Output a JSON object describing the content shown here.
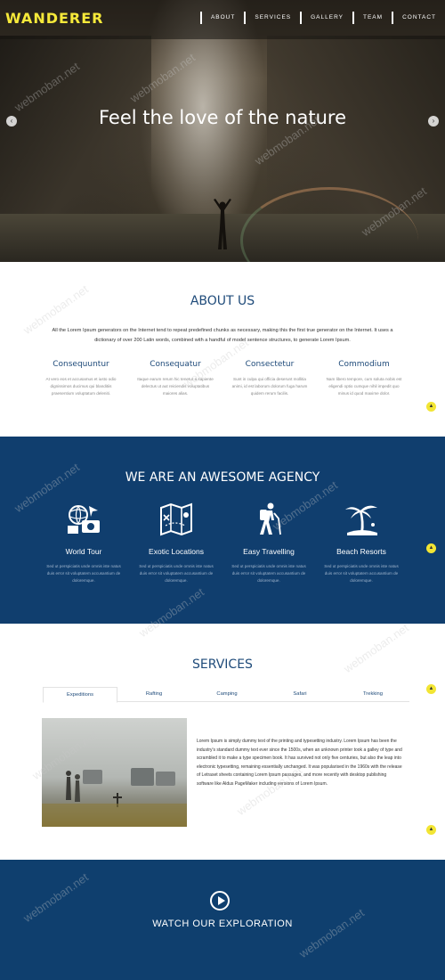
{
  "header": {
    "logo": "WANDERER",
    "nav": [
      "ABOUT",
      "SERVICES",
      "GALLERY",
      "TEAM",
      "CONTACT"
    ]
  },
  "hero": {
    "title": "Feel the love of the nature",
    "prev_icon": "chevron-left-icon",
    "next_icon": "chevron-right-icon"
  },
  "about": {
    "title": "ABOUT US",
    "text": "All the Lorem Ipsum generators on the Internet tend to repeat predefined chunks as necessary, making this the first true generator on the Internet. It uses a dictionary of over 200 Latin words, combined with a handful of model sentence structures, to generate Lorem Ipsum.",
    "features": [
      {
        "title": "Consequuntur",
        "text": "At vero eos et accusamus et iusto odio dignissimos ducimus qui blanditiis praesentium voluptatum deleniti."
      },
      {
        "title": "Consequatur",
        "text": "Itaque earum rerum hic tenetur a sapiente delectus ut aut reiciendis voluptatibus maiores alias."
      },
      {
        "title": "Consectetur",
        "text": "Sunt in culpa qui officia deserunt mollitia animi, id est laborum dolorum fuga harum quidem rerum facilis."
      },
      {
        "title": "Commodium",
        "text": "Nam libero tempore, cum soluta nobis est eligendi optio cumque nihil impedit quo minus id quod maxime dolor."
      }
    ]
  },
  "agency": {
    "title": "WE ARE AN AWESOME AGENCY",
    "features": [
      {
        "title": "World Tour",
        "icon": "world-tour-icon",
        "text": "Sed ut perspiciatis unde omnis iste natus duis error sit voluptatem accusantium de doloremque."
      },
      {
        "title": "Exotic Locations",
        "icon": "map-icon",
        "text": "Sed ut perspiciatis unde omnis iste natus duis error sit voluptatem accusantium de doloremque."
      },
      {
        "title": "Easy Travelling",
        "icon": "hiker-icon",
        "text": "Sed ut perspiciatis unde omnis iste natus duis error sit voluptatem accusantium de doloremque."
      },
      {
        "title": "Beach Resorts",
        "icon": "palm-tree-icon",
        "text": "Sed ut perspiciatis unde omnis iste natus duis error sit voluptatem accusantium de doloremque."
      }
    ]
  },
  "services": {
    "title": "SERVICES",
    "tabs": [
      "Expeditions",
      "Rafting",
      "Camping",
      "Safari",
      "Trekking"
    ],
    "active_tab": "Expeditions",
    "text": "Lorem Ipsum is simply dummy text of the printing and typesetting industry. Lorem Ipsum has been the industry's standard dummy text ever since the 1500s, when an unknown printer took a galley of type and scrambled it to make a type specimen book. It has survived not only five centuries, but also the leap into electronic typesetting, remaining essentially unchanged. It was popularised in the 1960s with the release of Letraset sheets containing Lorem Ipsum passages, and more recently with desktop publishing software like Aldus PageMaker including versions of Lorem Ipsum."
  },
  "video": {
    "title": "WATCH OUR EXPLORATION",
    "play_icon": "play-icon"
  },
  "watermark": "webmoban.net",
  "colors": {
    "logo": "#f6e93a",
    "navy": "#103e6e",
    "heading": "#1f4b7a",
    "accent_dot": "#f2e534"
  }
}
